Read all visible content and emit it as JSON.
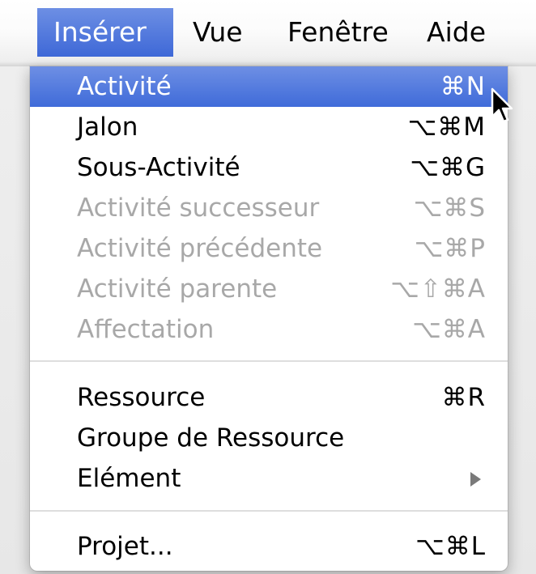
{
  "menubar": {
    "items": [
      {
        "label": "Insérer"
      },
      {
        "label": "Vue"
      },
      {
        "label": "Fenêtre"
      },
      {
        "label": "Aide"
      }
    ]
  },
  "menu": {
    "items": [
      {
        "label": "Activité",
        "shortcut": "⌘N"
      },
      {
        "label": "Jalon",
        "shortcut": "⌥⌘M"
      },
      {
        "label": "Sous-Activité",
        "shortcut": "⌥⌘G"
      },
      {
        "label": "Activité successeur",
        "shortcut": "⌥⌘S"
      },
      {
        "label": "Activité précédente",
        "shortcut": "⌥⌘P"
      },
      {
        "label": "Activité parente",
        "shortcut": "⌥⇧⌘A"
      },
      {
        "label": "Affectation",
        "shortcut": "⌥⌘A"
      },
      {
        "label": "Ressource",
        "shortcut": "⌘R"
      },
      {
        "label": "Groupe de Ressource",
        "shortcut": ""
      },
      {
        "label": "Elément",
        "shortcut": ""
      },
      {
        "label": "Projet...",
        "shortcut": "⌥⌘L"
      }
    ]
  },
  "colors": {
    "highlight": "#4a73dc",
    "disabled_text": "#a8a8a8"
  },
  "icons": {
    "submenu": "triangle-right-icon",
    "pointer": "mouse-pointer-icon"
  }
}
